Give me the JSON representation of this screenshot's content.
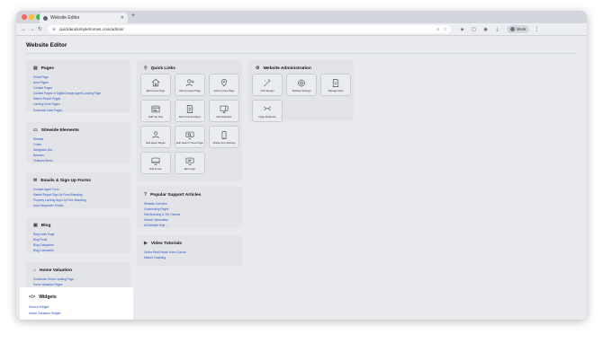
{
  "browser": {
    "tab_title": "Website Editor",
    "new_tab": "+",
    "url": "quicklandsimplehomes.com/admin/",
    "account_label": "Work",
    "colors": {
      "close": "#ff5f57",
      "minimize": "#febc2e",
      "maximize": "#28c840"
    }
  },
  "page": {
    "title": "Website Editor"
  },
  "pages_card": {
    "title": "Pages",
    "links": [
      "Home Page",
      "Area Pages",
      "Contact Pages",
      "Content Pages or Digital Design Agent Landing Page",
      "Market Report Pages",
      "Landing Zone Pages",
      "Economic Zone Pages"
    ]
  },
  "sitewide_card": {
    "title": "Sitewide Elements",
    "links": [
      "Website",
      "Footer",
      "Navigation Bar",
      "Banners",
      "Featured Items"
    ]
  },
  "emails_card": {
    "title": "Emails & Sign Up Forms",
    "links": [
      "Contact Agent Form",
      "Market Report Sign Up Form Branding",
      "Property Landing Sign Up Form Branding",
      "Auto Responder Emails"
    ]
  },
  "blog_card": {
    "title": "Blog",
    "links": [
      "Blog Index Page",
      "Blog Posts",
      "Blog Categories",
      "Blog Comments"
    ]
  },
  "home_valuation_card": {
    "title": "Home Valuation",
    "links": [
      "Customize Home Landing Page",
      "Home Valuation Pages"
    ]
  },
  "widgets_card": {
    "title": "Widgets",
    "links": [
      "Search Widget",
      "Home Valuation Widget"
    ]
  },
  "quick_links": {
    "title": "Quick Links",
    "tiles": [
      {
        "label": "Edit Home Page",
        "icon": "home"
      },
      {
        "label": "Add an Agent Page",
        "icon": "user-plus"
      },
      {
        "label": "Add an Area Page",
        "icon": "pin-plus"
      },
      {
        "label": "Edit Top Nav",
        "icon": "navbar"
      },
      {
        "label": "Edit Content Pages",
        "icon": "document"
      },
      {
        "label": "Edit Sidebars",
        "icon": "monitor"
      },
      {
        "label": "Edit Agent Pages",
        "icon": "user"
      },
      {
        "label": "Edit Search Three Page",
        "icon": "search-screen"
      },
      {
        "label": "Mobile App Settings",
        "icon": "phone"
      },
      {
        "label": "Edit Footer",
        "icon": "footer"
      },
      {
        "label": "Edit Login",
        "icon": "login"
      }
    ]
  },
  "support": {
    "title": "Popular Support Articles",
    "links": [
      "Website Overview",
      "Customizing Pages",
      "Site Branding & Tile Themes",
      "Search Information",
      "All Website Help →"
    ]
  },
  "videos": {
    "title": "Video Tutorials",
    "links": [
      "Online Real Estate Video Course",
      "Market Coaching"
    ]
  },
  "admin": {
    "title": "Website Administration",
    "tiles": [
      {
        "label": "CSS Design",
        "icon": "wand"
      },
      {
        "label": "Website Settings",
        "icon": "gear"
      },
      {
        "label": "Manage Files",
        "icon": "file"
      },
      {
        "label": "Page Redirects",
        "icon": "redirect"
      }
    ]
  }
}
